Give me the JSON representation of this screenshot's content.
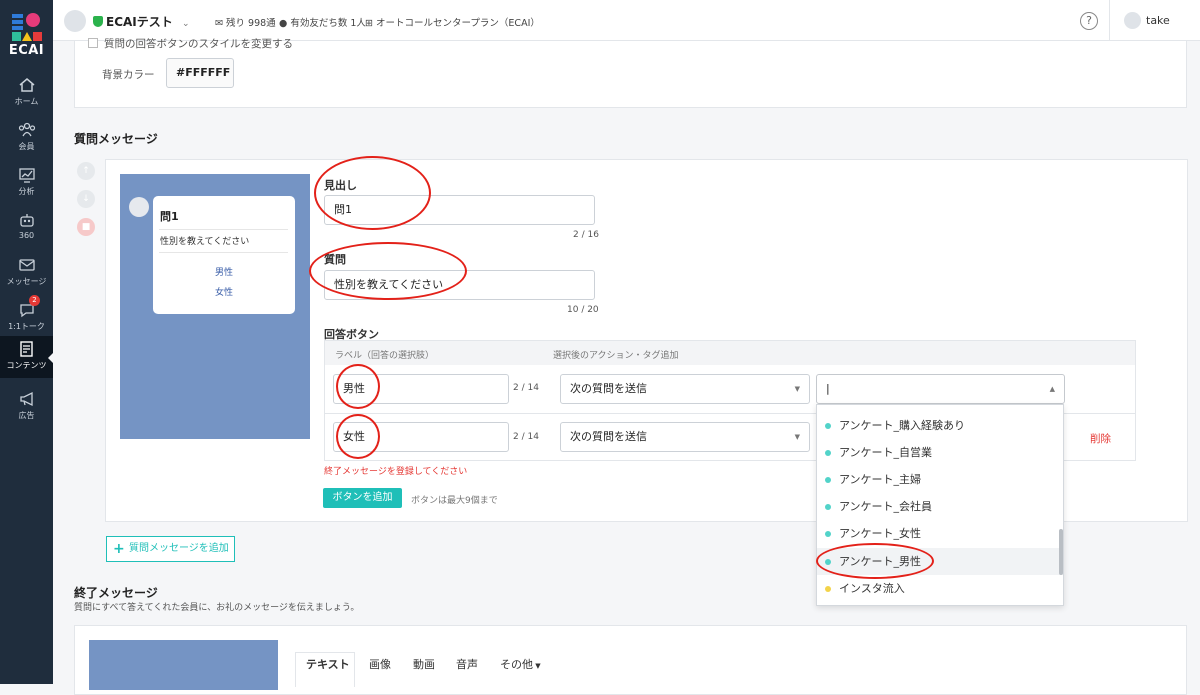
{
  "brand": {
    "logo_text": "ECAI"
  },
  "nav": [
    {
      "label": "ホーム",
      "icon": "home-icon"
    },
    {
      "label": "会員",
      "icon": "members-icon"
    },
    {
      "label": "分析",
      "icon": "chart-icon"
    },
    {
      "label": "360",
      "icon": "robot-icon"
    },
    {
      "label": "メッセージ",
      "icon": "mail-icon"
    },
    {
      "label": "1:1トーク",
      "icon": "chat-icon",
      "badge": "2"
    },
    {
      "label": "コンテンツ",
      "icon": "content-icon"
    },
    {
      "label": "広告",
      "icon": "megaphone-icon"
    }
  ],
  "topbar": {
    "account": "ECAIテスト",
    "remaining": "残り 998通",
    "friends": "有効友だち数 1人",
    "plan": "オートコールセンタープラン（ECAI）",
    "help": "?",
    "user": "take"
  },
  "top_panel": {
    "checkbox_label": "質問の回答ボタンのスタイルを変更する",
    "bg_label": "背景カラー",
    "bg_value": "#FFFFFF"
  },
  "question": {
    "section_title": "質問メッセージ",
    "preview": {
      "title": "問1",
      "question": "性別を教えてください",
      "options": [
        "男性",
        "女性"
      ]
    },
    "heading_label": "見出し",
    "heading_value": "問1",
    "heading_count": "2 / 16",
    "question_label": "質問",
    "question_value": "性別を教えてください",
    "question_count": "10 / 20",
    "answer_label": "回答ボタン",
    "col_label": "ラベル（回答の選択肢）",
    "col_action": "選択後のアクション・タグ追加",
    "rows": [
      {
        "label": "男性",
        "count": "2 / 14",
        "action": "次の質問を送信",
        "tag": "|"
      },
      {
        "label": "女性",
        "count": "2 / 14",
        "action": "次の質問を送信",
        "delete": "削除"
      }
    ],
    "error": "終了メッセージを登録してください",
    "add_button": "ボタンを追加",
    "add_note": "ボタンは最大9個まで"
  },
  "tag_dropdown": [
    {
      "label": "アンケート_購入経験あり",
      "color": "#52d3c9"
    },
    {
      "label": "アンケート_自営業",
      "color": "#52d3c9"
    },
    {
      "label": "アンケート_主婦",
      "color": "#52d3c9"
    },
    {
      "label": "アンケート_会社員",
      "color": "#52d3c9"
    },
    {
      "label": "アンケート_女性",
      "color": "#52d3c9"
    },
    {
      "label": "アンケート_男性",
      "color": "#52d3c9"
    },
    {
      "label": "インスタ流入",
      "color": "#f3d34a"
    }
  ],
  "add_question_button": "質問メッセージを追加",
  "end": {
    "title": "終了メッセージ",
    "desc": "質問にすべて答えてくれた会員に、お礼のメッセージを伝えましょう。",
    "tabs": [
      "テキスト",
      "画像",
      "動画",
      "音声",
      "その他"
    ]
  }
}
